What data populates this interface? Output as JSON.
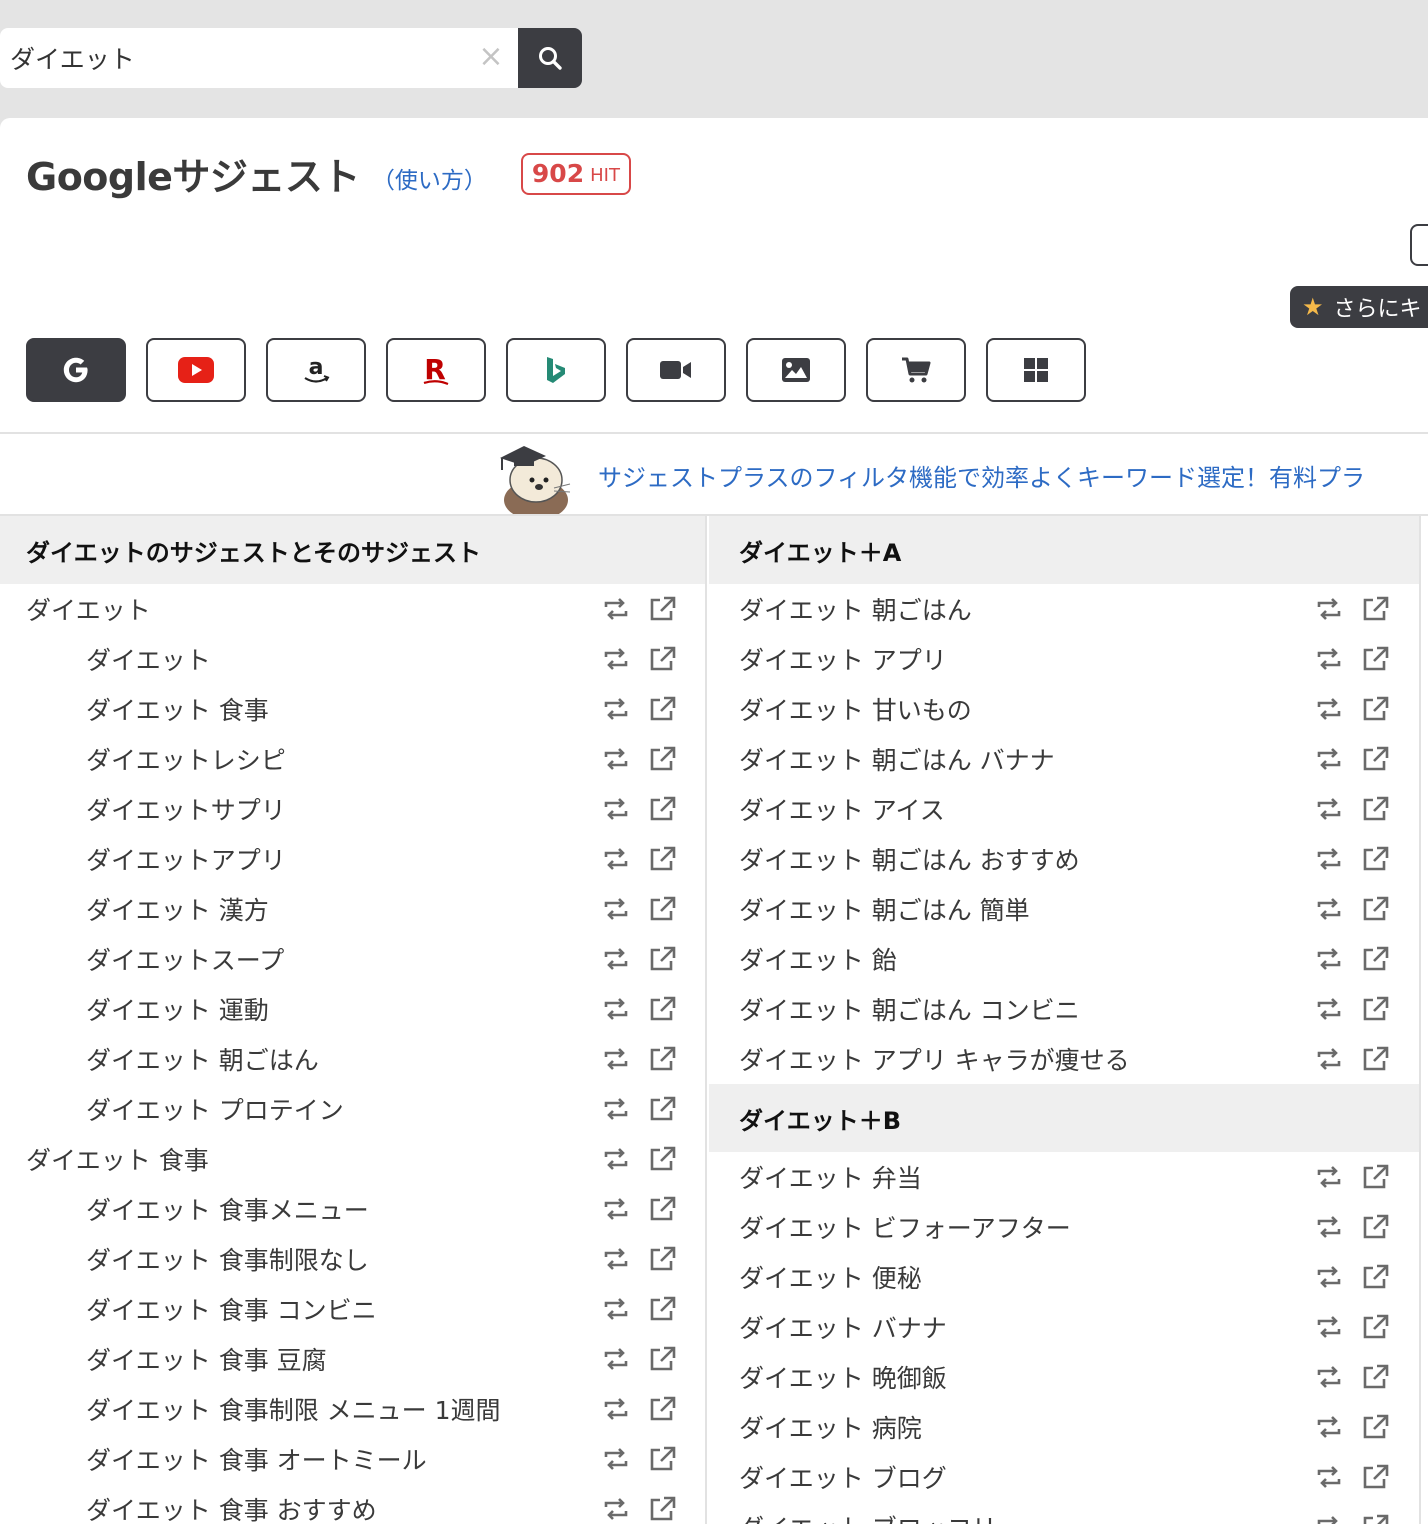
{
  "search": {
    "value": "ダイエット",
    "clear_icon": "close-icon",
    "submit_icon": "search-icon"
  },
  "header": {
    "title": "Googleサジェスト",
    "howto": "（使い方）",
    "hit_count": "902",
    "hit_unit": "HIT",
    "more_button": "さらにキ"
  },
  "engines": [
    {
      "name": "google",
      "icon": "google-icon",
      "active": true
    },
    {
      "name": "youtube",
      "icon": "youtube-icon",
      "active": false
    },
    {
      "name": "amazon",
      "icon": "amazon-icon",
      "active": false
    },
    {
      "name": "rakuten",
      "icon": "rakuten-icon",
      "active": false
    },
    {
      "name": "bing",
      "icon": "bing-icon",
      "active": false
    },
    {
      "name": "video",
      "icon": "video-camera-icon",
      "active": false
    },
    {
      "name": "image",
      "icon": "image-icon",
      "active": false
    },
    {
      "name": "shopping",
      "icon": "cart-icon",
      "active": false
    },
    {
      "name": "microsoft",
      "icon": "windows-icon",
      "active": false
    }
  ],
  "banner": {
    "text": "サジェストプラスのフィルタ機能で効率よくキーワード選定！有料プラ"
  },
  "left_column": {
    "header": "ダイエットのサジェストとそのサジェスト",
    "rows": [
      {
        "text": "ダイエット",
        "child": false
      },
      {
        "text": "ダイエット",
        "child": true
      },
      {
        "text": "ダイエット 食事",
        "child": true
      },
      {
        "text": "ダイエットレシピ",
        "child": true
      },
      {
        "text": "ダイエットサプリ",
        "child": true
      },
      {
        "text": "ダイエットアプリ",
        "child": true
      },
      {
        "text": "ダイエット 漢方",
        "child": true
      },
      {
        "text": "ダイエットスープ",
        "child": true
      },
      {
        "text": "ダイエット 運動",
        "child": true
      },
      {
        "text": "ダイエット 朝ごはん",
        "child": true
      },
      {
        "text": "ダイエット プロテイン",
        "child": true
      },
      {
        "text": "ダイエット 食事",
        "child": false
      },
      {
        "text": "ダイエット 食事メニュー",
        "child": true
      },
      {
        "text": "ダイエット 食事制限なし",
        "child": true
      },
      {
        "text": "ダイエット 食事 コンビニ",
        "child": true
      },
      {
        "text": "ダイエット 食事 豆腐",
        "child": true
      },
      {
        "text": "ダイエット 食事制限 メニュー 1週間",
        "child": true
      },
      {
        "text": "ダイエット 食事 オートミール",
        "child": true
      },
      {
        "text": "ダイエット 食事 おすすめ",
        "child": true
      }
    ]
  },
  "right_column": {
    "groups": [
      {
        "header": "ダイエット＋A",
        "rows": [
          "ダイエット 朝ごはん",
          "ダイエット アプリ",
          "ダイエット 甘いもの",
          "ダイエット 朝ごはん バナナ",
          "ダイエット アイス",
          "ダイエット 朝ごはん おすすめ",
          "ダイエット 朝ごはん 簡単",
          "ダイエット 飴",
          "ダイエット 朝ごはん コンビニ",
          "ダイエット アプリ キャラが痩せる"
        ]
      },
      {
        "header": "ダイエット＋B",
        "rows": [
          "ダイエット 弁当",
          "ダイエット ビフォーアフター",
          "ダイエット 便秘",
          "ダイエット バナナ",
          "ダイエット 晩御飯",
          "ダイエット 病院",
          "ダイエット ブログ",
          "ダイエット ブロッコリー"
        ]
      }
    ]
  },
  "row_actions": {
    "resuggest_icon": "repeat-icon",
    "open_icon": "external-link-icon"
  },
  "colors": {
    "dark": "#3c3d42",
    "link": "#2d6bc4",
    "hit": "#d84848",
    "header_bg": "#efefef"
  }
}
